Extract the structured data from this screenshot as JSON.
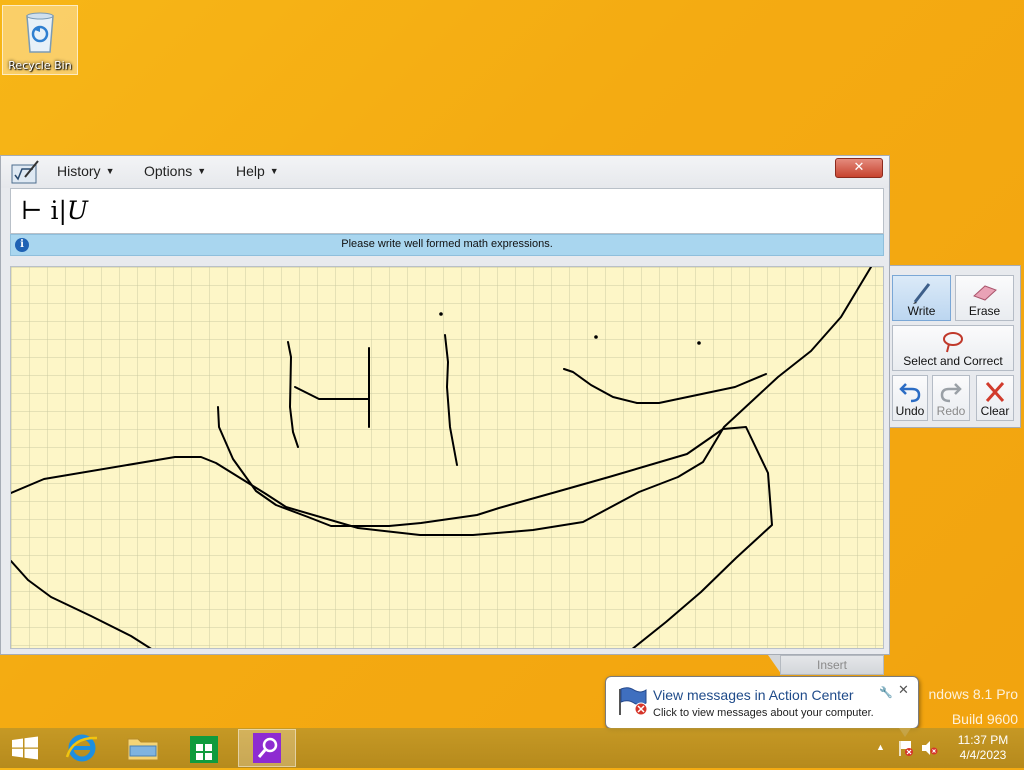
{
  "desktop": {
    "recycle_bin_label": "Recycle Bin",
    "watermark_line1": "ndows 8.1 Pro",
    "watermark_line2": "Build 9600"
  },
  "math_panel": {
    "menus": [
      {
        "label": "History"
      },
      {
        "label": "Options"
      },
      {
        "label": "Help"
      }
    ],
    "close_glyph": "✕",
    "preview_expression_prefix": "⊢ i|",
    "preview_expression_var": "U",
    "info_message": "Please write well formed math expressions.",
    "tools": {
      "write": "Write",
      "erase": "Erase",
      "select_correct": "Select and Correct",
      "undo": "Undo",
      "redo": "Redo",
      "clear": "Clear"
    },
    "insert_label": "Insert"
  },
  "notification": {
    "title": "View messages in Action Center",
    "subtitle": "Click to view messages about your computer."
  },
  "taskbar": {
    "pinned": [
      "start",
      "internet-explorer",
      "file-explorer",
      "store",
      "math-input-panel"
    ],
    "clock_time": "11:37 PM",
    "clock_date": "4/4/2023"
  },
  "colors": {
    "desktop": "#f4ab12",
    "canvas": "#fdf6c7",
    "info_bar": "#a9d6ef",
    "close_button": "#c7432f"
  }
}
